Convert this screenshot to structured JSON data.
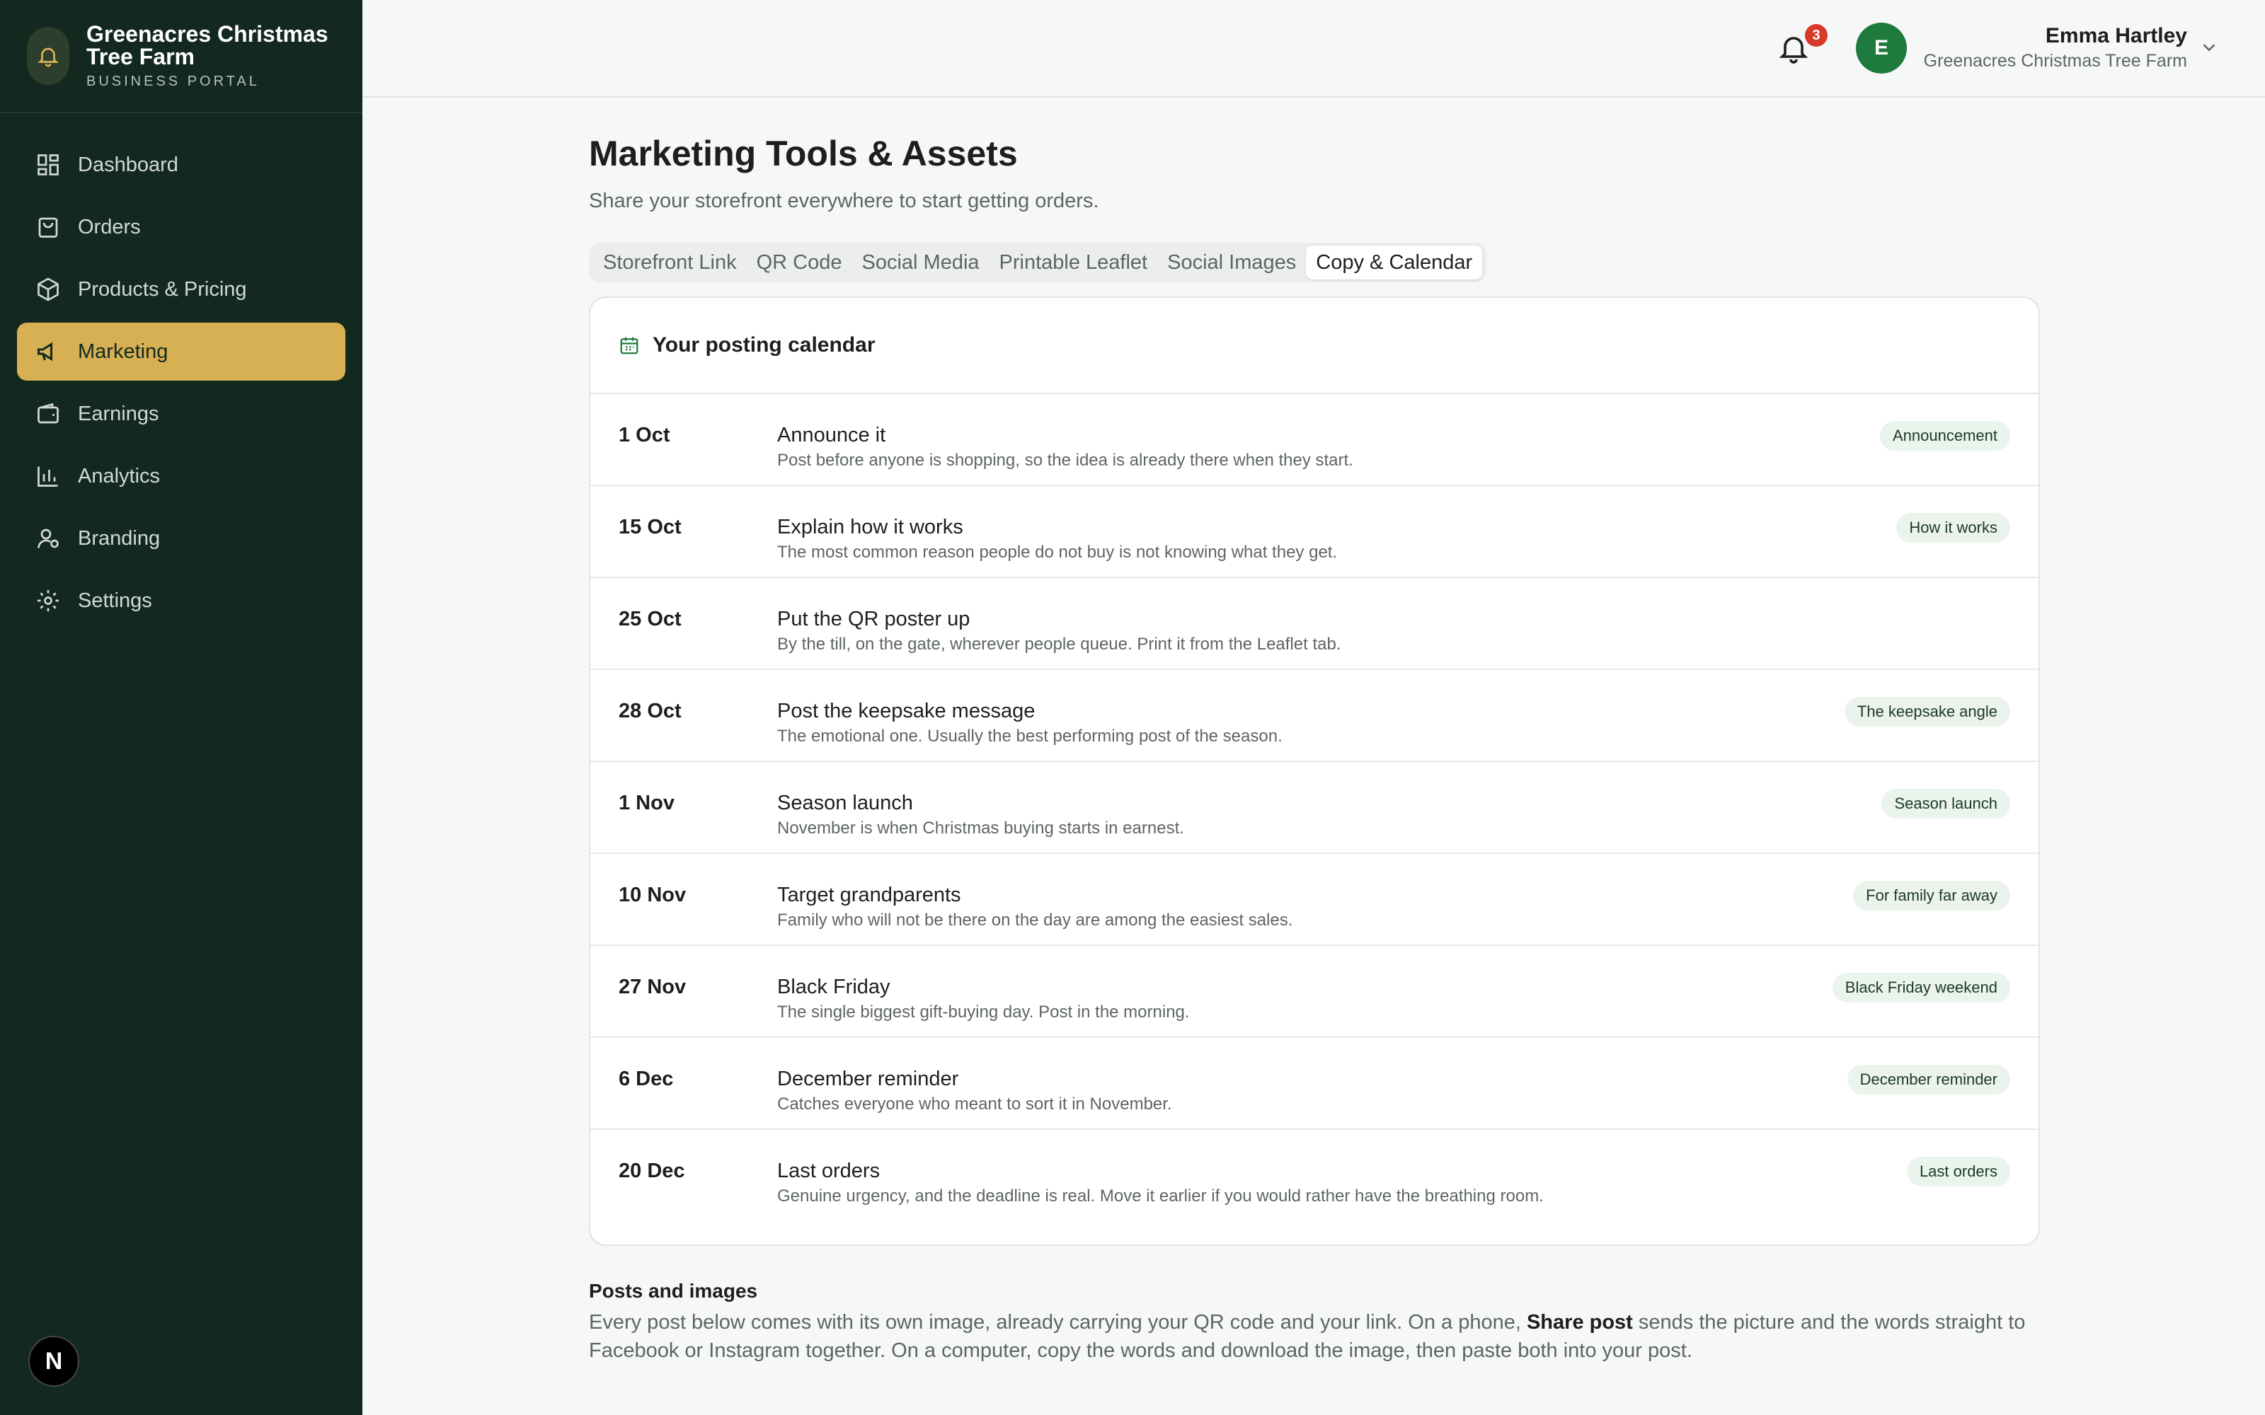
{
  "brand": {
    "name": "Greenacres Christmas Tree Farm",
    "subtitle": "BUSINESS PORTAL"
  },
  "sidebar": {
    "items": [
      {
        "label": "Dashboard",
        "icon": "dashboard-icon"
      },
      {
        "label": "Orders",
        "icon": "shopping-bag-icon"
      },
      {
        "label": "Products & Pricing",
        "icon": "package-icon"
      },
      {
        "label": "Marketing",
        "icon": "megaphone-icon",
        "active": true
      },
      {
        "label": "Earnings",
        "icon": "wallet-icon"
      },
      {
        "label": "Analytics",
        "icon": "bar-chart-icon"
      },
      {
        "label": "Branding",
        "icon": "user-brand-icon"
      },
      {
        "label": "Settings",
        "icon": "gear-icon"
      }
    ],
    "footer_badge": "N"
  },
  "header": {
    "notification_count": "3",
    "avatar_initial": "E",
    "user_name": "Emma Hartley",
    "user_org": "Greenacres Christmas Tree Farm"
  },
  "main": {
    "title": "Marketing Tools & Assets",
    "subtitle": "Share your storefront everywhere to start getting orders.",
    "tabs": [
      {
        "label": "Storefront Link"
      },
      {
        "label": "QR Code"
      },
      {
        "label": "Social Media"
      },
      {
        "label": "Printable Leaflet"
      },
      {
        "label": "Social Images"
      },
      {
        "label": "Copy & Calendar",
        "active": true
      }
    ],
    "calendar": {
      "title": "Your posting calendar",
      "rows": [
        {
          "date": "1 Oct",
          "title": "Announce it",
          "desc": "Post before anyone is shopping, so the idea is already there when they start.",
          "tag": "Announcement"
        },
        {
          "date": "15 Oct",
          "title": "Explain how it works",
          "desc": "The most common reason people do not buy is not knowing what they get.",
          "tag": "How it works"
        },
        {
          "date": "25 Oct",
          "title": "Put the QR poster up",
          "desc": "By the till, on the gate, wherever people queue. Print it from the Leaflet tab.",
          "tag": ""
        },
        {
          "date": "28 Oct",
          "title": "Post the keepsake message",
          "desc": "The emotional one. Usually the best performing post of the season.",
          "tag": "The keepsake angle"
        },
        {
          "date": "1 Nov",
          "title": "Season launch",
          "desc": "November is when Christmas buying starts in earnest.",
          "tag": "Season launch"
        },
        {
          "date": "10 Nov",
          "title": "Target grandparents",
          "desc": "Family who will not be there on the day are among the easiest sales.",
          "tag": "For family far away"
        },
        {
          "date": "27 Nov",
          "title": "Black Friday",
          "desc": "The single biggest gift-buying day. Post in the morning.",
          "tag": "Black Friday weekend"
        },
        {
          "date": "6 Dec",
          "title": "December reminder",
          "desc": "Catches everyone who meant to sort it in November.",
          "tag": "December reminder"
        },
        {
          "date": "20 Dec",
          "title": "Last orders",
          "desc": "Genuine urgency, and the deadline is real. Move it earlier if you would rather have the breathing room.",
          "tag": "Last orders"
        }
      ]
    },
    "posts": {
      "title": "Posts and images",
      "text_before": "Every post below comes with its own image, already carrying your QR code and your link. On a phone, ",
      "text_bold": "Share post",
      "text_after": " sends the picture and the words straight to Facebook or Instagram together. On a computer, copy the words and download the image, then paste both into your post."
    }
  },
  "colors": {
    "sidebar_bg": "#13291f",
    "active_nav": "#d6b052",
    "accent_green": "#1f7a3d",
    "badge_red": "#d83a2a"
  }
}
